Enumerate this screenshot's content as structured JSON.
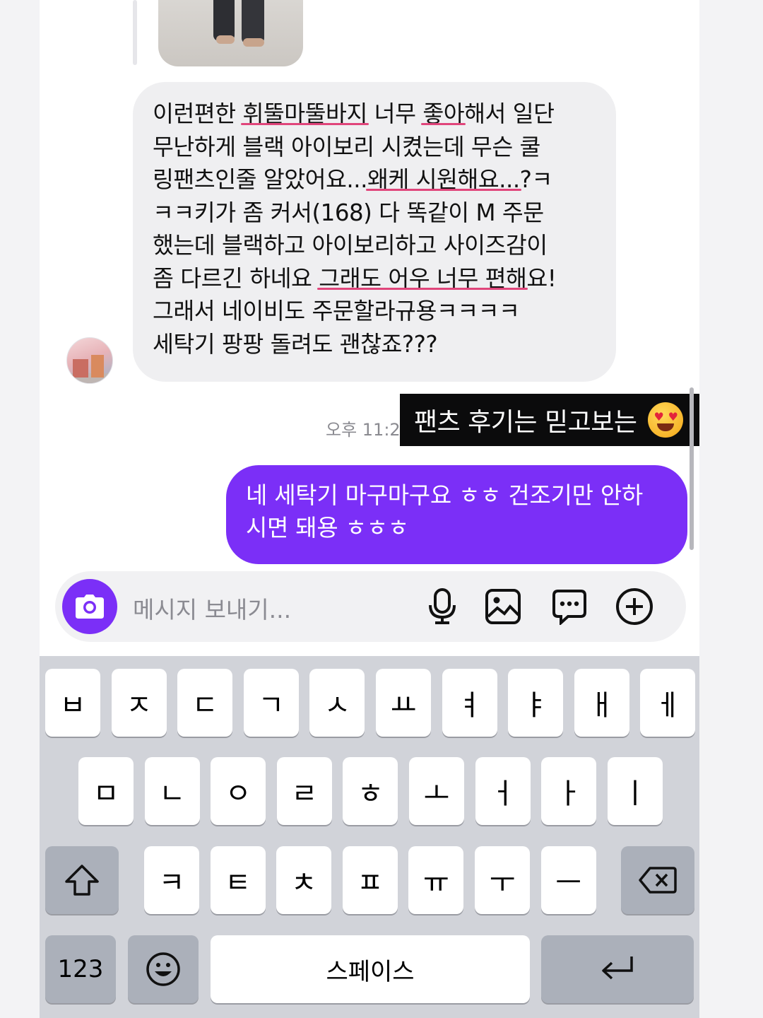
{
  "incoming_message": {
    "lines": [
      [
        "이런편한 ",
        {
          "hl": "휘뚤마뚤바지"
        },
        " 너무 ",
        {
          "hl": "좋아"
        },
        "해서 일단"
      ],
      [
        "무난하게 블랙 아이보리 시켰는데 무슨 쿨"
      ],
      [
        "링팬츠인줄 알았어요...",
        {
          "hl": "왜케 시원해요..."
        },
        "?ㅋ"
      ],
      [
        "ㅋㅋ키가 좀 커서(168) 다 똑같이 M 주문"
      ],
      [
        "했는데 블랙하고 아이보리하고 사이즈감이"
      ],
      [
        "좀 다르긴 하네요 ",
        {
          "hl": "그래도 어우 너무 편해"
        },
        "요!"
      ],
      [
        "그래서 네이비도 주문할라규용ㅋㅋㅋㅋ"
      ],
      [
        "세탁기 팡팡 돌려도 괜찮죠???"
      ]
    ]
  },
  "timestamp": "오후 11:2",
  "sticker": {
    "text": "팬츠 후기는 믿고보는",
    "emoji": "heart-eyes-emoji"
  },
  "outgoing_message": {
    "line1": "네 세탁기 마구마구요 ㅎㅎ 건조기만 안하",
    "line2": "시면 돼용 ㅎㅎㅎ"
  },
  "composer": {
    "placeholder": "메시지 보내기...",
    "icons": [
      "camera-icon",
      "microphone-icon",
      "image-icon",
      "sticker-chat-icon",
      "plus-icon"
    ]
  },
  "keyboard": {
    "row1": [
      "ㅂ",
      "ㅈ",
      "ㄷ",
      "ㄱ",
      "ㅅ",
      "ㅛ",
      "ㅕ",
      "ㅑ",
      "ㅐ",
      "ㅔ"
    ],
    "row2": [
      "ㅁ",
      "ㄴ",
      "ㅇ",
      "ㄹ",
      "ㅎ",
      "ㅗ",
      "ㅓ",
      "ㅏ",
      "ㅣ"
    ],
    "row3": [
      "ㅋ",
      "ㅌ",
      "ㅊ",
      "ㅍ",
      "ㅠ",
      "ㅜ",
      "ㅡ"
    ],
    "numbers_label": "123",
    "space_label": "스페이스",
    "accent": "#7b2ff7"
  }
}
